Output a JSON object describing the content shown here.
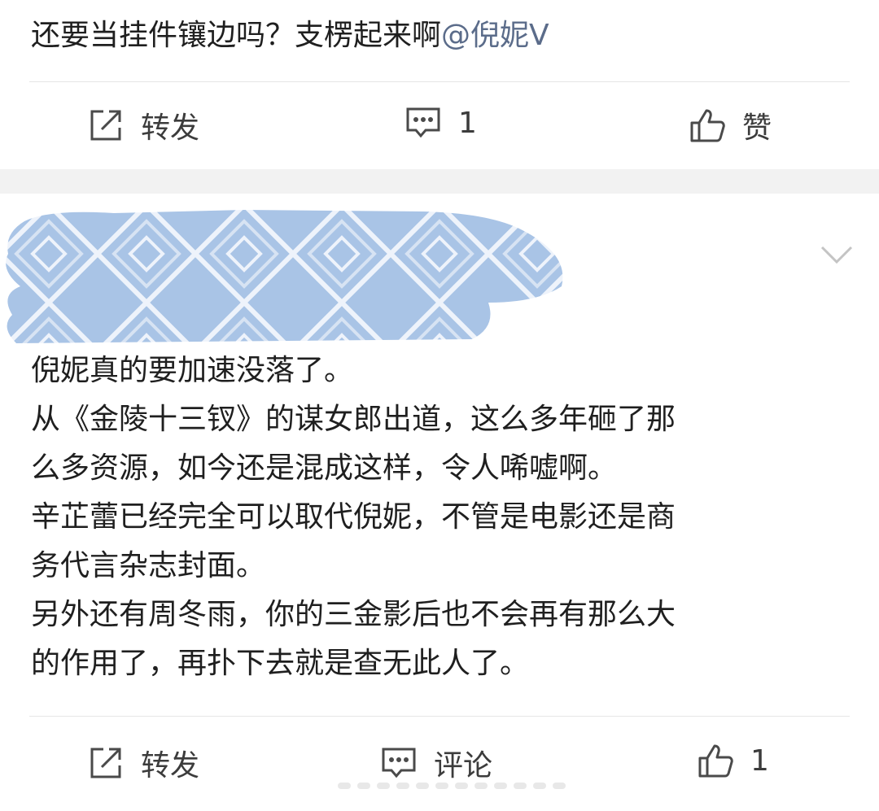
{
  "post1": {
    "text_main": "还要当挂件镶边吗？支楞起来啊",
    "mention": "@倪妮V",
    "actions": {
      "repost_label": "转发",
      "comment_count": "1",
      "like_label": "赞"
    }
  },
  "post2": {
    "lines": [
      "倪妮真的要加速没落了。",
      "从《金陵十三钗》的谋女郎出道，这么多年砸了那",
      "么多资源，如今还是混成这样，令人唏嘘啊。",
      "辛芷蕾已经完全可以取代倪妮，不管是电影还是商",
      "务代言杂志封面。",
      "另外还有周冬雨，你的三金影后也不会再有那么大",
      "的作用了，再扑下去就是查无此人了。"
    ],
    "actions": {
      "repost_label": "转发",
      "comment_label": "评论",
      "like_count": "1"
    }
  },
  "colors": {
    "mention": "#5b6c8a",
    "separator": "#f2f2f2",
    "blur_fill": "#a9c4e6"
  },
  "icons": [
    "repost-icon",
    "comment-icon",
    "like-icon",
    "chevron-down-icon"
  ]
}
